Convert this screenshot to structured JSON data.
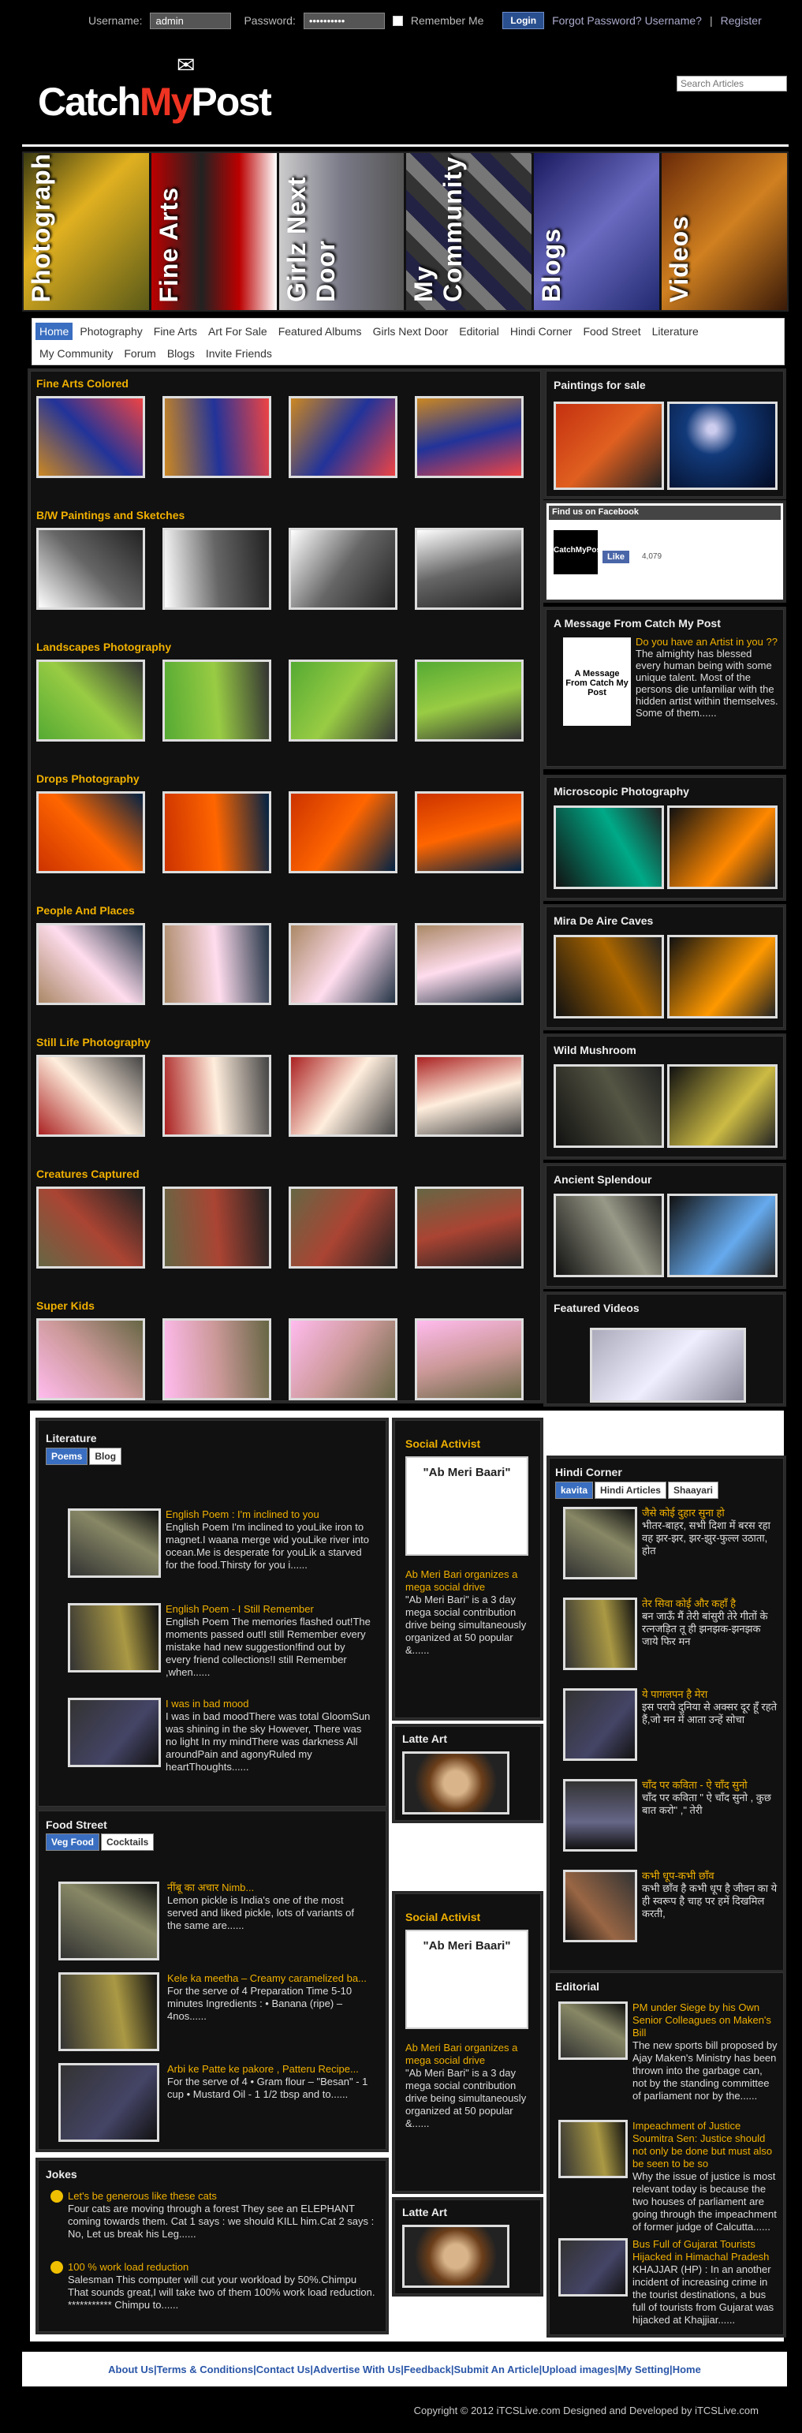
{
  "topbar": {
    "username_label": "Username:",
    "username_value": "admin",
    "password_label": "Password:",
    "password_value": "••••••••••",
    "remember": "Remember Me",
    "login": "Login",
    "forgot": "Forgot Password? Username?",
    "sep": "|",
    "register": "Register"
  },
  "logo": {
    "catch": "Catch",
    "my": "My",
    "post": "Post"
  },
  "search": {
    "placeholder": "Search Articles"
  },
  "banner": [
    "Photography",
    "Fine Arts",
    "Girlz Next Door",
    "My Community",
    "Blogs",
    "Videos"
  ],
  "nav": {
    "row1": [
      "Home",
      "Photography",
      "Fine Arts",
      "Art For Sale",
      "Featured Albums",
      "Girls Next Door",
      "Editorial",
      "Hindi Corner",
      "Food Street",
      "Literature"
    ],
    "row2": [
      "My Community",
      "Forum",
      "Blogs",
      "Invite Friends"
    ]
  },
  "galleries": [
    "Fine Arts Colored",
    "B/W Paintings and Sketches",
    "Landscapes Photography",
    "Drops Photography",
    "People And Places",
    "Still Life Photography",
    "Creatures Captured",
    "Super Kids"
  ],
  "side": {
    "paintings": "Paintings for sale",
    "facebook": {
      "title": "Find us on Facebook",
      "brand": "CatchMyPost",
      "like": "Like",
      "count": "4,079"
    },
    "message": {
      "title": "A Message From Catch My Post",
      "headline": "Do you have an Artist in you ??",
      "body": "The almighty has blessed every human being with some unique talent. Most of the persons die unfamiliar with the hidden artist within themselves. Some of them......"
    },
    "albums": [
      "Microscopic Photography",
      "Mira De Aire Caves",
      "Wild Mushroom",
      "Ancient Splendour"
    ],
    "videos": "Featured Videos"
  },
  "literature": {
    "title": "Literature",
    "tabs": [
      "Poems",
      "Blog"
    ],
    "items": [
      {
        "head": "English Poem : I'm inclined to you",
        "body": "English Poem I'm inclined to youLike iron to magnet.I waana merge wid youLike river into ocean.Me is desperate for youLik a starved for the food.Thirsty for you i......"
      },
      {
        "head": "English Poem - I Still Remember",
        "body": "English Poem The memories flashed out!The moments passed out!I still Remember every mistake had new suggestion!find out by every friend collections!I still Remember ,when......"
      },
      {
        "head": "I was in bad mood",
        "body": "I was in bad moodThere was total GloomSun was shining in the sky However, There was no light In my mindThere was darkness All aroundPain and agonyRuled my heartThoughts......"
      }
    ]
  },
  "social": {
    "title": "Social Activist",
    "logo": "\"Ab Meri Baari\"",
    "head": "Ab Meri Bari organizes a mega social drive",
    "body": "\"Ab Meri Bari\" is a 3 day mega social contribution drive being simultaneously organized at 50 popular &......"
  },
  "latte": "Latte Art",
  "hindi": {
    "title": "Hindi Corner",
    "tabs": [
      "kavita",
      "Hindi Articles",
      "Shaayari"
    ],
    "items": [
      {
        "head": "जैसे कोई दुहार सुना हो",
        "body": "भीतर-बाहर, सभी दिशा में बरस रहा वह झर-झर, झर-झुर-फुल्ल उठाता, होत"
      },
      {
        "head": "तेर सिवा कोई और कहाँ है",
        "body": "बन जाऊँ मैं तेरी बांसुरी तेरे गीतों के रत्नजड़ित तू ही झनझक-झनझक जाये फिर मन"
      },
      {
        "head": "ये पागलपन है मेरा",
        "body": "इस पराये दुनिया से अक्सर दूर हूँ रहते हैं,जो मन में आता उन्हें सोचा"
      },
      {
        "head": "चाँद पर कविता - ऐ चाँद सुनो",
        "body": "चाँद पर कविता \" ऐ चाँद सुनो , कुछ बात करो\" ,\" तेरी"
      },
      {
        "head": "कभी धूप-कभी छाँव",
        "body": "कभी छाँव है कभी धूप है जीवन का ये ही स्वरूप है चाह पर हमें दिखमिल करती,"
      }
    ]
  },
  "food": {
    "title": "Food Street",
    "tabs": [
      "Veg Food",
      "Cocktails"
    ],
    "items": [
      {
        "head": "नींबू का अचार Nimb...",
        "body": "Lemon pickle is India's one of the most served and liked pickle, lots of variants of the same are......"
      },
      {
        "head": "Kele ka meetha – Creamy caramelized ba...",
        "body": "For the serve of 4 Preparation Time 5-10 minutes Ingredients : • Banana (ripe) – 4nos......"
      },
      {
        "head": "Arbi ke Patte ke pakore , Patteru Recipe...",
        "body": "For the serve of 4 • Gram flour – \"Besan\" - 1 cup • Mustard Oil - 1 1/2 tbsp and to......"
      }
    ]
  },
  "jokes": {
    "title": "Jokes",
    "items": [
      {
        "head": "Let's be generous like these cats",
        "body": "Four cats are moving through a forest They see an ELEPHANT coming towards them. Cat 1 says : we should KILL him.Cat 2 says : No, Let us break his Leg......"
      },
      {
        "head": "100 % work load reduction",
        "body": "Salesman This computer will cut your workload by 50%.Chimpu That sounds great,I will take two of them 100% work load reduction. *********** Chimpu to......"
      }
    ]
  },
  "editorial": {
    "title": "Editorial",
    "items": [
      {
        "head": "PM under Siege by his Own Senior Colleagues on Maken's Bill",
        "body": "The new sports bill proposed by Ajay Maken's Ministry has been thrown into the garbage can, not by the standing committee of parliament nor by the......"
      },
      {
        "head": "Impeachment of Justice Soumitra Sen: Justice should not only be done but must also be seen to be so",
        "body": "Why the issue of justice is most relevant today is because the two houses of parliament are going through the impeachment of former judge of Calcutta......"
      },
      {
        "head": "Bus Full of Gujarat Tourists Hijacked in Himachal Pradesh",
        "body": "KHAJJAR (HP) : In an another incident of increasing crime in the tourist destinations, a bus full of tourists from Gujarat was hijacked at Khajjiar......"
      }
    ]
  },
  "footer": [
    "About Us",
    "Terms & Conditions",
    "Contact Us",
    "Advertise With Us",
    "Feedback",
    "Submit An Article",
    "Upload images",
    "My Setting",
    "Home"
  ],
  "copyright": "Copyright © 2012 iTCSLive.com  Designed and Developed by iTCSLive.com"
}
